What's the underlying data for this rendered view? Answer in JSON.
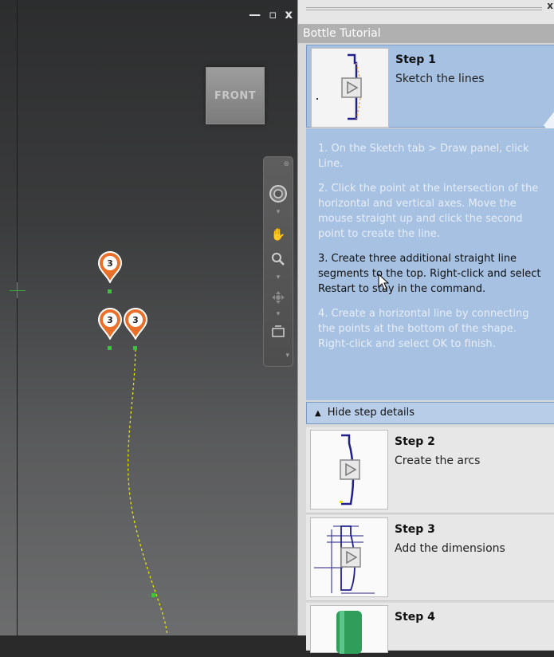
{
  "viewport": {
    "viewcube_label": "FRONT",
    "window_buttons": [
      "—",
      "▫",
      "x"
    ],
    "pins": [
      {
        "label": "3"
      },
      {
        "label": "3"
      },
      {
        "label": "3"
      }
    ]
  },
  "panel": {
    "title": "Bottle Tutorial",
    "close": "x",
    "hide_details_label": "Hide step details",
    "steps": [
      {
        "title": "Step 1",
        "desc": "Sketch the lines"
      },
      {
        "title": "Step 2",
        "desc": "Create the arcs"
      },
      {
        "title": "Step 3",
        "desc": "Add the dimensions"
      },
      {
        "title": "Step 4",
        "desc": ""
      }
    ],
    "details": [
      "1. On the Sketch tab > Draw panel, click Line.",
      "2. Click the point at the intersection of the horizontal and vertical axes. Move the mouse straight up and click the second point to create the line.",
      "3. Create three additional straight line segments to the top. Right-click and select Restart to stay in the command.",
      "4. Create a horizontal line by connecting the points at the bottom of the shape. Right-click and select OK to finish."
    ],
    "active_detail_index": 2
  },
  "colors": {
    "pin": "#e8702a",
    "sketch_line": "#e6e600",
    "selected_step": "#a6c1e2",
    "thumb_line": "#20208a"
  }
}
